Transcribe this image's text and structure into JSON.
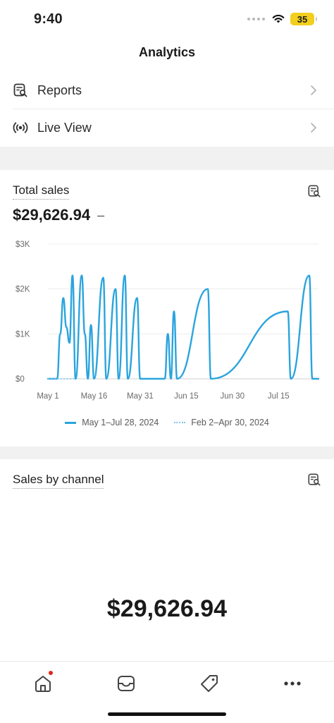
{
  "status_bar": {
    "time": "9:40",
    "battery": "35"
  },
  "header": {
    "title": "Analytics"
  },
  "menu": [
    {
      "label": "Reports",
      "icon": "report-search-icon"
    },
    {
      "label": "Live View",
      "icon": "live-broadcast-icon"
    }
  ],
  "total_sales": {
    "title": "Total sales",
    "value": "$29,626.94",
    "comparison": "–"
  },
  "chart_data": {
    "type": "line",
    "y_tick_labels": [
      "$0",
      "$1K",
      "$2K",
      "$3K"
    ],
    "x_tick_labels": [
      "May 1",
      "May 16",
      "May 31",
      "Jun 15",
      "Jun 30",
      "Jul 15"
    ],
    "ylim": [
      0,
      3000
    ],
    "grid": true,
    "legend_position": "bottom",
    "series": [
      {
        "name": "May 1–Jul 28, 2024",
        "color": "#2aa4dd",
        "style": "solid",
        "points": [
          [
            "2024-05-01",
            0
          ],
          [
            "2024-05-04",
            0
          ],
          [
            "2024-05-05",
            1000
          ],
          [
            "2024-05-06",
            1800
          ],
          [
            "2024-05-07",
            1150
          ],
          [
            "2024-05-08",
            800
          ],
          [
            "2024-05-09",
            2300
          ],
          [
            "2024-05-10",
            0
          ],
          [
            "2024-05-12",
            2300
          ],
          [
            "2024-05-13",
            1000
          ],
          [
            "2024-05-14",
            0
          ],
          [
            "2024-05-15",
            1200
          ],
          [
            "2024-05-16",
            0
          ],
          [
            "2024-05-19",
            2250
          ],
          [
            "2024-05-20",
            0
          ],
          [
            "2024-05-23",
            2000
          ],
          [
            "2024-05-24",
            0
          ],
          [
            "2024-05-26",
            2300
          ],
          [
            "2024-05-27",
            0
          ],
          [
            "2024-05-30",
            1800
          ],
          [
            "2024-05-31",
            0
          ],
          [
            "2024-06-08",
            0
          ],
          [
            "2024-06-09",
            1000
          ],
          [
            "2024-06-10",
            0
          ],
          [
            "2024-06-11",
            1500
          ],
          [
            "2024-06-12",
            0
          ],
          [
            "2024-06-22",
            2000
          ],
          [
            "2024-06-23",
            0
          ],
          [
            "2024-07-18",
            1500
          ],
          [
            "2024-07-19",
            0
          ],
          [
            "2024-07-25",
            2300
          ],
          [
            "2024-07-26",
            0
          ],
          [
            "2024-07-28",
            0
          ]
        ]
      },
      {
        "name": "Feb 2–Apr 30, 2024",
        "color": "#7fc6e8",
        "style": "dotted",
        "points": [
          [
            "2024-05-01",
            0
          ],
          [
            "2024-05-10",
            0
          ]
        ]
      }
    ]
  },
  "sales_by_channel": {
    "title": "Sales by channel",
    "value": "$29,626.94"
  },
  "bottom_nav": [
    {
      "icon": "home-icon"
    },
    {
      "icon": "inbox-icon"
    },
    {
      "icon": "tag-icon"
    },
    {
      "icon": "more-icon"
    }
  ]
}
